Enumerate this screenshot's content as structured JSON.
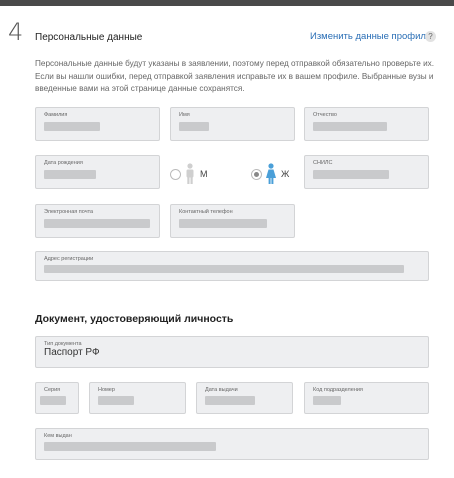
{
  "step": {
    "number": "4",
    "title": "Персональные данные"
  },
  "header": {
    "change_link": "Изменить данные профиля",
    "help": "?"
  },
  "intro": "Персональные данные будут указаны в заявлении, поэтому перед отправкой обязательно проверьте их. Если вы нашли ошибки, перед отправкой заявления исправьте их в вашем профиле. Выбранные вузы и введенные вами на этой странице данные сохранятся.",
  "fields": {
    "surname": {
      "label": "Фамилия"
    },
    "name": {
      "label": "Имя"
    },
    "patronymic": {
      "label": "Отчество"
    },
    "birthdate": {
      "label": "Дата рождения"
    },
    "snils": {
      "label": "СНИЛС"
    },
    "email": {
      "label": "Электронная почта"
    },
    "phone": {
      "label": "Контактный телефон"
    },
    "address": {
      "label": "Адрес регистрации"
    }
  },
  "gender": {
    "male": "М",
    "female": "Ж",
    "selected": "female"
  },
  "document": {
    "title": "Документ, удостоверяющий личность",
    "type": {
      "label": "Тип документа",
      "value": "Паспорт РФ"
    },
    "series": {
      "label": "Серия"
    },
    "number": {
      "label": "Номер"
    },
    "issue_date": {
      "label": "Дата выдачи"
    },
    "division_code": {
      "label": "Код подразделения"
    },
    "issued_by": {
      "label": "Кем выдан"
    }
  },
  "colors": {
    "accent": "#2b6fb6",
    "field_bg": "#eeeff1",
    "female_icon": "#4a9fd8",
    "male_icon": "#cfcfcf"
  }
}
